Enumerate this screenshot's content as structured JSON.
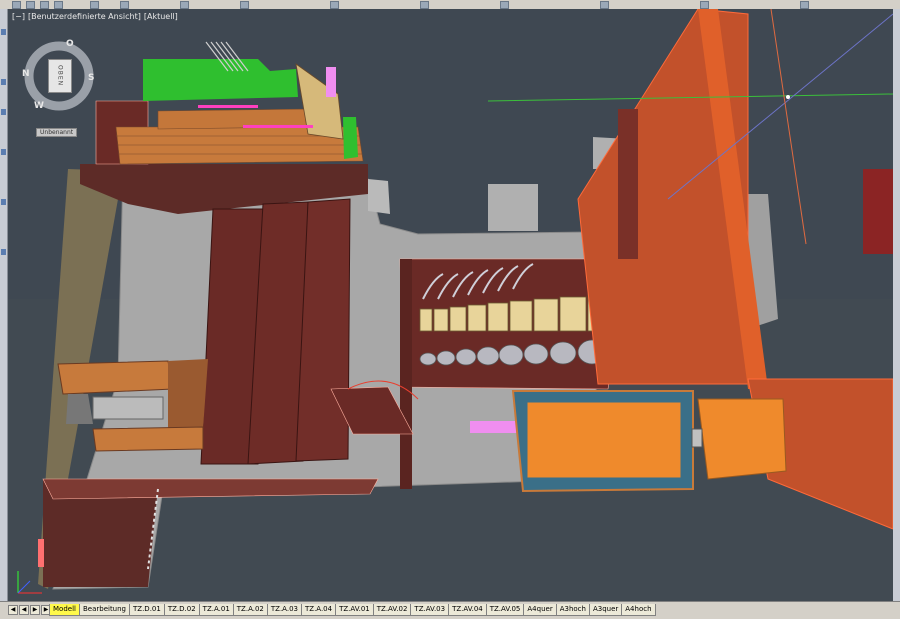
{
  "viewport": {
    "label_parts": [
      "[−]",
      "[Benutzerdefinierte Ansicht]",
      "[Aktuell]"
    ],
    "viewcube": {
      "face": "OBEN",
      "north": "N",
      "south": "S",
      "west": "W",
      "east": "O"
    },
    "wcs_label": "Unbenannt"
  },
  "layout_tabs": {
    "nav": [
      "◀",
      "◀",
      "▶",
      "▶"
    ],
    "tabs": [
      "Modell",
      "Bearbeitung",
      "TZ.D.01",
      "TZ.D.02",
      "TZ.A.01",
      "TZ.A.02",
      "TZ.A.03",
      "TZ.A.04",
      "TZ.AV.01",
      "TZ.AV.02",
      "TZ.AV.03",
      "TZ.AV.04",
      "TZ.AV.05",
      "A4quer",
      "A3hoch",
      "A3quer",
      "A4hoch"
    ],
    "active": "Modell"
  },
  "colors": {
    "background": "#3f4852",
    "concrete": "#a9a9a9",
    "dark_red": "#6a2a26",
    "orange_red": "#c2512b",
    "wood": "#c77a3c",
    "orange": "#ef8a2c",
    "green": "#2fbf2f",
    "pink": "#f08ef0"
  }
}
